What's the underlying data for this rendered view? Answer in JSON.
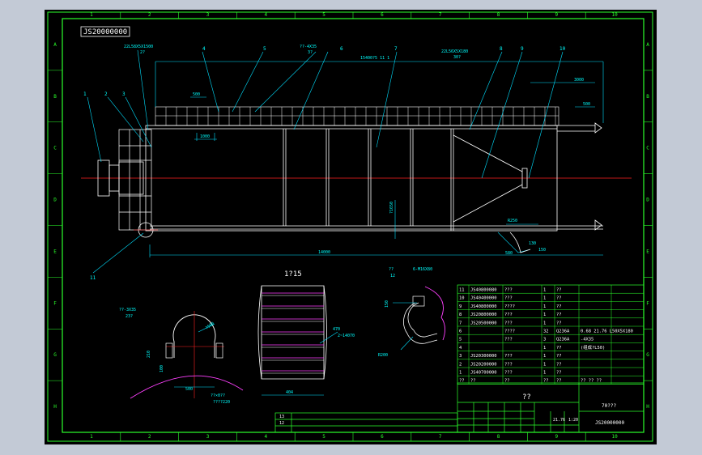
{
  "drawing": {
    "code_box": "JS20000000",
    "section_title": "1?15",
    "grid_cols": [
      "1",
      "2",
      "3",
      "4",
      "5",
      "6",
      "7",
      "8",
      "9",
      "10"
    ],
    "grid_rows": [
      "A",
      "B",
      "C",
      "D",
      "E",
      "F",
      "G",
      "H"
    ]
  },
  "main_view": {
    "dim_top_left": "22L58X5X1500",
    "dim_top_left_qty": "2?",
    "dim_mid": "??-4X35",
    "dim_mid_qty": "3?",
    "dim_top_span": "15400?5 11 1",
    "dim_right_part": "22L56X5X180",
    "dim_right_part_qty": "30?",
    "dim_500_top": "500",
    "dim_1000": "1000",
    "dim_3000": "3000",
    "dim_500_right": "500",
    "dim_height": "?1650",
    "dim_length": "14000",
    "dim_r": "R250",
    "dim_580": "580",
    "dim_130": "130",
    "dim_150": "150",
    "callouts": [
      "1",
      "2",
      "3",
      "4",
      "5",
      "6",
      "7",
      "8",
      "9",
      "10",
      "11"
    ]
  },
  "detail_a": {
    "label_top": "??-3X35",
    "label_top_qty": "23?",
    "d_phi": "?500",
    "d_210": "210",
    "d_100": "100",
    "d_500": "500",
    "label_bot": "??×0??",
    "label_bot2": "????220"
  },
  "detail_b": {
    "d_470": "470",
    "d_note": "2~14070",
    "d_404": "404"
  },
  "detail_c": {
    "label_top": "??",
    "label_top2": "12",
    "label_part": "6-M16X80",
    "d_r": "R200",
    "d_150": "150"
  },
  "parts_table": {
    "rows": [
      {
        "no": "11",
        "code": "JS40800080",
        "name": "???",
        "qty": "1",
        "mat": "??",
        "note": ""
      },
      {
        "no": "10",
        "code": "JS40400000",
        "name": "???",
        "qty": "1",
        "mat": "??",
        "note": ""
      },
      {
        "no": "9",
        "code": "JS40800000",
        "name": "????",
        "qty": "1",
        "mat": "??",
        "note": ""
      },
      {
        "no": "8",
        "code": "JS20800000",
        "name": "???",
        "qty": "1",
        "mat": "??",
        "note": ""
      },
      {
        "no": "7",
        "code": "JS20500000",
        "name": "???",
        "qty": "1",
        "mat": "??",
        "note": ""
      },
      {
        "no": "6",
        "code": "",
        "name": "????",
        "qty": "32",
        "mat": "Q236A",
        "note": "0.68 21.76 L50X5X180"
      },
      {
        "no": "5",
        "code": "",
        "name": "???",
        "qty": "3",
        "mat": "Q236A",
        "note": "-4X35"
      },
      {
        "no": "4",
        "code": "",
        "name": "",
        "qty": "1",
        "mat": "??",
        "note": "(组成?L50)"
      },
      {
        "no": "3",
        "code": "JS20300000",
        "name": "???",
        "qty": "1",
        "mat": "??",
        "note": ""
      },
      {
        "no": "2",
        "code": "JS20200000",
        "name": "???",
        "qty": "1",
        "mat": "??",
        "note": ""
      },
      {
        "no": "1",
        "code": "JS40700000",
        "name": "???",
        "qty": "1",
        "mat": "??",
        "note": ""
      }
    ],
    "header": {
      "no": "??",
      "code": "??",
      "name": "??",
      "qty": "??",
      "mat": "??",
      "note": "?? ?? ??"
    }
  },
  "title_block": {
    "title": "??",
    "name_right": "70???",
    "drawing_no": "JS20000000",
    "scale_label": "1:20",
    "weight": "21.76",
    "row12": "12",
    "row13": "13"
  }
}
